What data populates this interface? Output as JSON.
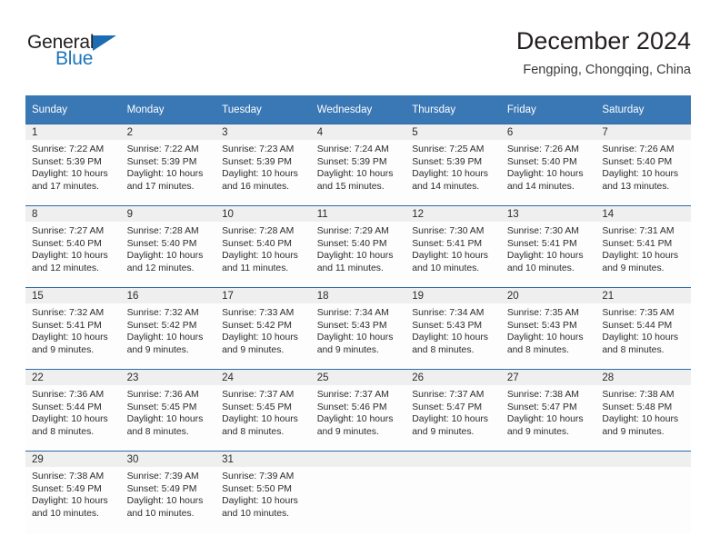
{
  "brand": {
    "name_part1": "General",
    "name_part2": "Blue",
    "triangle_icon": "triangle-icon",
    "color_primary": "#1b75bc",
    "color_dark": "#231f20"
  },
  "header": {
    "title": "December 2024",
    "subtitle": "Fengping, Chongqing, China"
  },
  "theme": {
    "header_bg": "#3a77b5",
    "row_divider": "#2a6ba8",
    "daynum_bg": "#efefef",
    "cell_bg": "#fdfdfd"
  },
  "weekday_headers": [
    "Sunday",
    "Monday",
    "Tuesday",
    "Wednesday",
    "Thursday",
    "Friday",
    "Saturday"
  ],
  "labels": {
    "sunrise_prefix": "Sunrise:",
    "sunset_prefix": "Sunset:",
    "daylight_prefix": "Daylight:"
  },
  "weeks": [
    [
      {
        "day": "1",
        "sunrise": "Sunrise: 7:22 AM",
        "sunset": "Sunset: 5:39 PM",
        "daylight_l1": "Daylight: 10 hours",
        "daylight_l2": "and 17 minutes."
      },
      {
        "day": "2",
        "sunrise": "Sunrise: 7:22 AM",
        "sunset": "Sunset: 5:39 PM",
        "daylight_l1": "Daylight: 10 hours",
        "daylight_l2": "and 17 minutes."
      },
      {
        "day": "3",
        "sunrise": "Sunrise: 7:23 AM",
        "sunset": "Sunset: 5:39 PM",
        "daylight_l1": "Daylight: 10 hours",
        "daylight_l2": "and 16 minutes."
      },
      {
        "day": "4",
        "sunrise": "Sunrise: 7:24 AM",
        "sunset": "Sunset: 5:39 PM",
        "daylight_l1": "Daylight: 10 hours",
        "daylight_l2": "and 15 minutes."
      },
      {
        "day": "5",
        "sunrise": "Sunrise: 7:25 AM",
        "sunset": "Sunset: 5:39 PM",
        "daylight_l1": "Daylight: 10 hours",
        "daylight_l2": "and 14 minutes."
      },
      {
        "day": "6",
        "sunrise": "Sunrise: 7:26 AM",
        "sunset": "Sunset: 5:40 PM",
        "daylight_l1": "Daylight: 10 hours",
        "daylight_l2": "and 14 minutes."
      },
      {
        "day": "7",
        "sunrise": "Sunrise: 7:26 AM",
        "sunset": "Sunset: 5:40 PM",
        "daylight_l1": "Daylight: 10 hours",
        "daylight_l2": "and 13 minutes."
      }
    ],
    [
      {
        "day": "8",
        "sunrise": "Sunrise: 7:27 AM",
        "sunset": "Sunset: 5:40 PM",
        "daylight_l1": "Daylight: 10 hours",
        "daylight_l2": "and 12 minutes."
      },
      {
        "day": "9",
        "sunrise": "Sunrise: 7:28 AM",
        "sunset": "Sunset: 5:40 PM",
        "daylight_l1": "Daylight: 10 hours",
        "daylight_l2": "and 12 minutes."
      },
      {
        "day": "10",
        "sunrise": "Sunrise: 7:28 AM",
        "sunset": "Sunset: 5:40 PM",
        "daylight_l1": "Daylight: 10 hours",
        "daylight_l2": "and 11 minutes."
      },
      {
        "day": "11",
        "sunrise": "Sunrise: 7:29 AM",
        "sunset": "Sunset: 5:40 PM",
        "daylight_l1": "Daylight: 10 hours",
        "daylight_l2": "and 11 minutes."
      },
      {
        "day": "12",
        "sunrise": "Sunrise: 7:30 AM",
        "sunset": "Sunset: 5:41 PM",
        "daylight_l1": "Daylight: 10 hours",
        "daylight_l2": "and 10 minutes."
      },
      {
        "day": "13",
        "sunrise": "Sunrise: 7:30 AM",
        "sunset": "Sunset: 5:41 PM",
        "daylight_l1": "Daylight: 10 hours",
        "daylight_l2": "and 10 minutes."
      },
      {
        "day": "14",
        "sunrise": "Sunrise: 7:31 AM",
        "sunset": "Sunset: 5:41 PM",
        "daylight_l1": "Daylight: 10 hours",
        "daylight_l2": "and 9 minutes."
      }
    ],
    [
      {
        "day": "15",
        "sunrise": "Sunrise: 7:32 AM",
        "sunset": "Sunset: 5:41 PM",
        "daylight_l1": "Daylight: 10 hours",
        "daylight_l2": "and 9 minutes."
      },
      {
        "day": "16",
        "sunrise": "Sunrise: 7:32 AM",
        "sunset": "Sunset: 5:42 PM",
        "daylight_l1": "Daylight: 10 hours",
        "daylight_l2": "and 9 minutes."
      },
      {
        "day": "17",
        "sunrise": "Sunrise: 7:33 AM",
        "sunset": "Sunset: 5:42 PM",
        "daylight_l1": "Daylight: 10 hours",
        "daylight_l2": "and 9 minutes."
      },
      {
        "day": "18",
        "sunrise": "Sunrise: 7:34 AM",
        "sunset": "Sunset: 5:43 PM",
        "daylight_l1": "Daylight: 10 hours",
        "daylight_l2": "and 9 minutes."
      },
      {
        "day": "19",
        "sunrise": "Sunrise: 7:34 AM",
        "sunset": "Sunset: 5:43 PM",
        "daylight_l1": "Daylight: 10 hours",
        "daylight_l2": "and 8 minutes."
      },
      {
        "day": "20",
        "sunrise": "Sunrise: 7:35 AM",
        "sunset": "Sunset: 5:43 PM",
        "daylight_l1": "Daylight: 10 hours",
        "daylight_l2": "and 8 minutes."
      },
      {
        "day": "21",
        "sunrise": "Sunrise: 7:35 AM",
        "sunset": "Sunset: 5:44 PM",
        "daylight_l1": "Daylight: 10 hours",
        "daylight_l2": "and 8 minutes."
      }
    ],
    [
      {
        "day": "22",
        "sunrise": "Sunrise: 7:36 AM",
        "sunset": "Sunset: 5:44 PM",
        "daylight_l1": "Daylight: 10 hours",
        "daylight_l2": "and 8 minutes."
      },
      {
        "day": "23",
        "sunrise": "Sunrise: 7:36 AM",
        "sunset": "Sunset: 5:45 PM",
        "daylight_l1": "Daylight: 10 hours",
        "daylight_l2": "and 8 minutes."
      },
      {
        "day": "24",
        "sunrise": "Sunrise: 7:37 AM",
        "sunset": "Sunset: 5:45 PM",
        "daylight_l1": "Daylight: 10 hours",
        "daylight_l2": "and 8 minutes."
      },
      {
        "day": "25",
        "sunrise": "Sunrise: 7:37 AM",
        "sunset": "Sunset: 5:46 PM",
        "daylight_l1": "Daylight: 10 hours",
        "daylight_l2": "and 9 minutes."
      },
      {
        "day": "26",
        "sunrise": "Sunrise: 7:37 AM",
        "sunset": "Sunset: 5:47 PM",
        "daylight_l1": "Daylight: 10 hours",
        "daylight_l2": "and 9 minutes."
      },
      {
        "day": "27",
        "sunrise": "Sunrise: 7:38 AM",
        "sunset": "Sunset: 5:47 PM",
        "daylight_l1": "Daylight: 10 hours",
        "daylight_l2": "and 9 minutes."
      },
      {
        "day": "28",
        "sunrise": "Sunrise: 7:38 AM",
        "sunset": "Sunset: 5:48 PM",
        "daylight_l1": "Daylight: 10 hours",
        "daylight_l2": "and 9 minutes."
      }
    ],
    [
      {
        "day": "29",
        "sunrise": "Sunrise: 7:38 AM",
        "sunset": "Sunset: 5:49 PM",
        "daylight_l1": "Daylight: 10 hours",
        "daylight_l2": "and 10 minutes."
      },
      {
        "day": "30",
        "sunrise": "Sunrise: 7:39 AM",
        "sunset": "Sunset: 5:49 PM",
        "daylight_l1": "Daylight: 10 hours",
        "daylight_l2": "and 10 minutes."
      },
      {
        "day": "31",
        "sunrise": "Sunrise: 7:39 AM",
        "sunset": "Sunset: 5:50 PM",
        "daylight_l1": "Daylight: 10 hours",
        "daylight_l2": "and 10 minutes."
      },
      {
        "day": "",
        "sunrise": "",
        "sunset": "",
        "daylight_l1": "",
        "daylight_l2": ""
      },
      {
        "day": "",
        "sunrise": "",
        "sunset": "",
        "daylight_l1": "",
        "daylight_l2": ""
      },
      {
        "day": "",
        "sunrise": "",
        "sunset": "",
        "daylight_l1": "",
        "daylight_l2": ""
      },
      {
        "day": "",
        "sunrise": "",
        "sunset": "",
        "daylight_l1": "",
        "daylight_l2": ""
      }
    ]
  ]
}
